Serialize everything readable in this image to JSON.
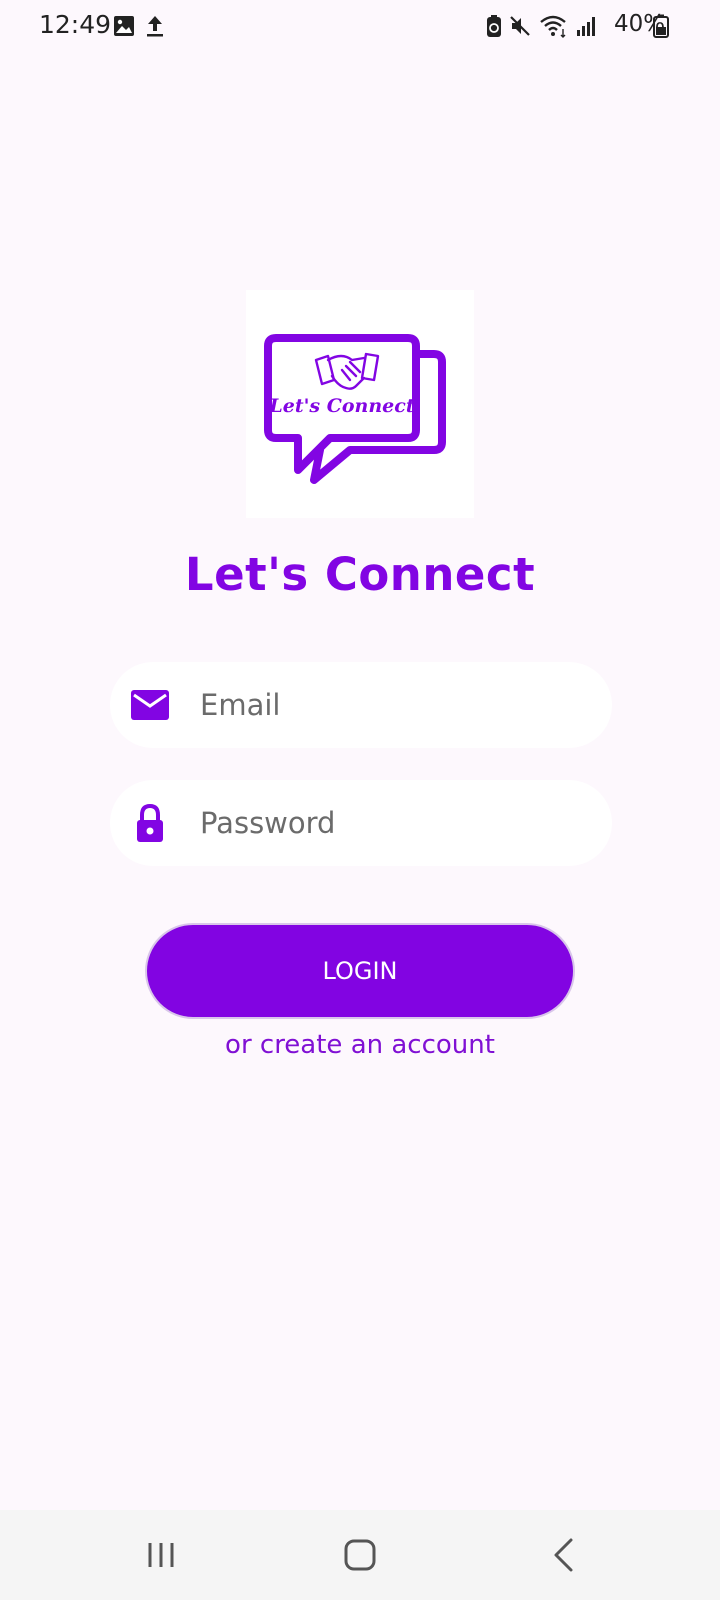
{
  "status_bar": {
    "time": "12:49",
    "battery": "40%",
    "icons": [
      "image-icon",
      "upload-icon",
      "battery-saver-icon",
      "mute-icon",
      "wifi-icon",
      "signal-icon",
      "battery-icon"
    ]
  },
  "logo": {
    "text": "Let's Connect",
    "icon": "handshake-chat-logo"
  },
  "app_title": "Let's Connect",
  "form": {
    "email": {
      "placeholder": "Email",
      "value": "",
      "icon": "mail-icon"
    },
    "password": {
      "placeholder": "Password",
      "value": "",
      "icon": "lock-icon"
    },
    "login_label": "LOGIN",
    "create_account_label": "or create an account"
  },
  "nav": {
    "icons": [
      "recent-apps-icon",
      "home-icon",
      "back-icon"
    ]
  },
  "colors": {
    "accent": "#8205e3",
    "background": "#fdf8fd",
    "field_background": "#ffffff"
  }
}
